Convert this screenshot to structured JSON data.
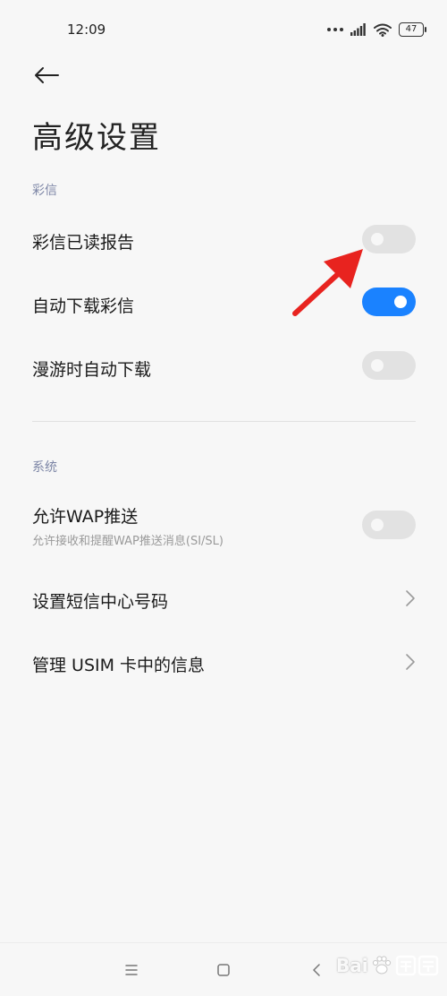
{
  "status_bar": {
    "time": "12:09",
    "battery": "47",
    "icons": [
      "more-dots-icon",
      "signal-icon",
      "wifi-icon",
      "battery-icon"
    ]
  },
  "header": {
    "back_icon": "back-arrow-icon",
    "title": "高级设置"
  },
  "sections": [
    {
      "label": "彩信",
      "items": [
        {
          "title": "彩信已读报告",
          "control": "toggle",
          "checked": false
        },
        {
          "title": "自动下载彩信",
          "control": "toggle",
          "checked": true
        },
        {
          "title": "漫游时自动下载",
          "control": "toggle",
          "checked": false
        }
      ]
    },
    {
      "label": "系统",
      "items": [
        {
          "title": "允许WAP推送",
          "subtitle": "允许接收和提醒WAP推送消息(SI/SL)",
          "control": "toggle",
          "checked": false
        },
        {
          "title": "设置短信中心号码",
          "control": "chevron"
        },
        {
          "title": "管理 USIM 卡中的信息",
          "control": "chevron"
        }
      ]
    }
  ],
  "nav_bar": {
    "icons": [
      "menu-icon",
      "home-icon",
      "back-icon"
    ]
  },
  "watermark": {
    "text": "Bai"
  },
  "colors": {
    "accent": "#1a82ff",
    "toggle_off": "#e2e2e2",
    "section_label": "#7d86a6",
    "annotation": "#e8231f"
  }
}
